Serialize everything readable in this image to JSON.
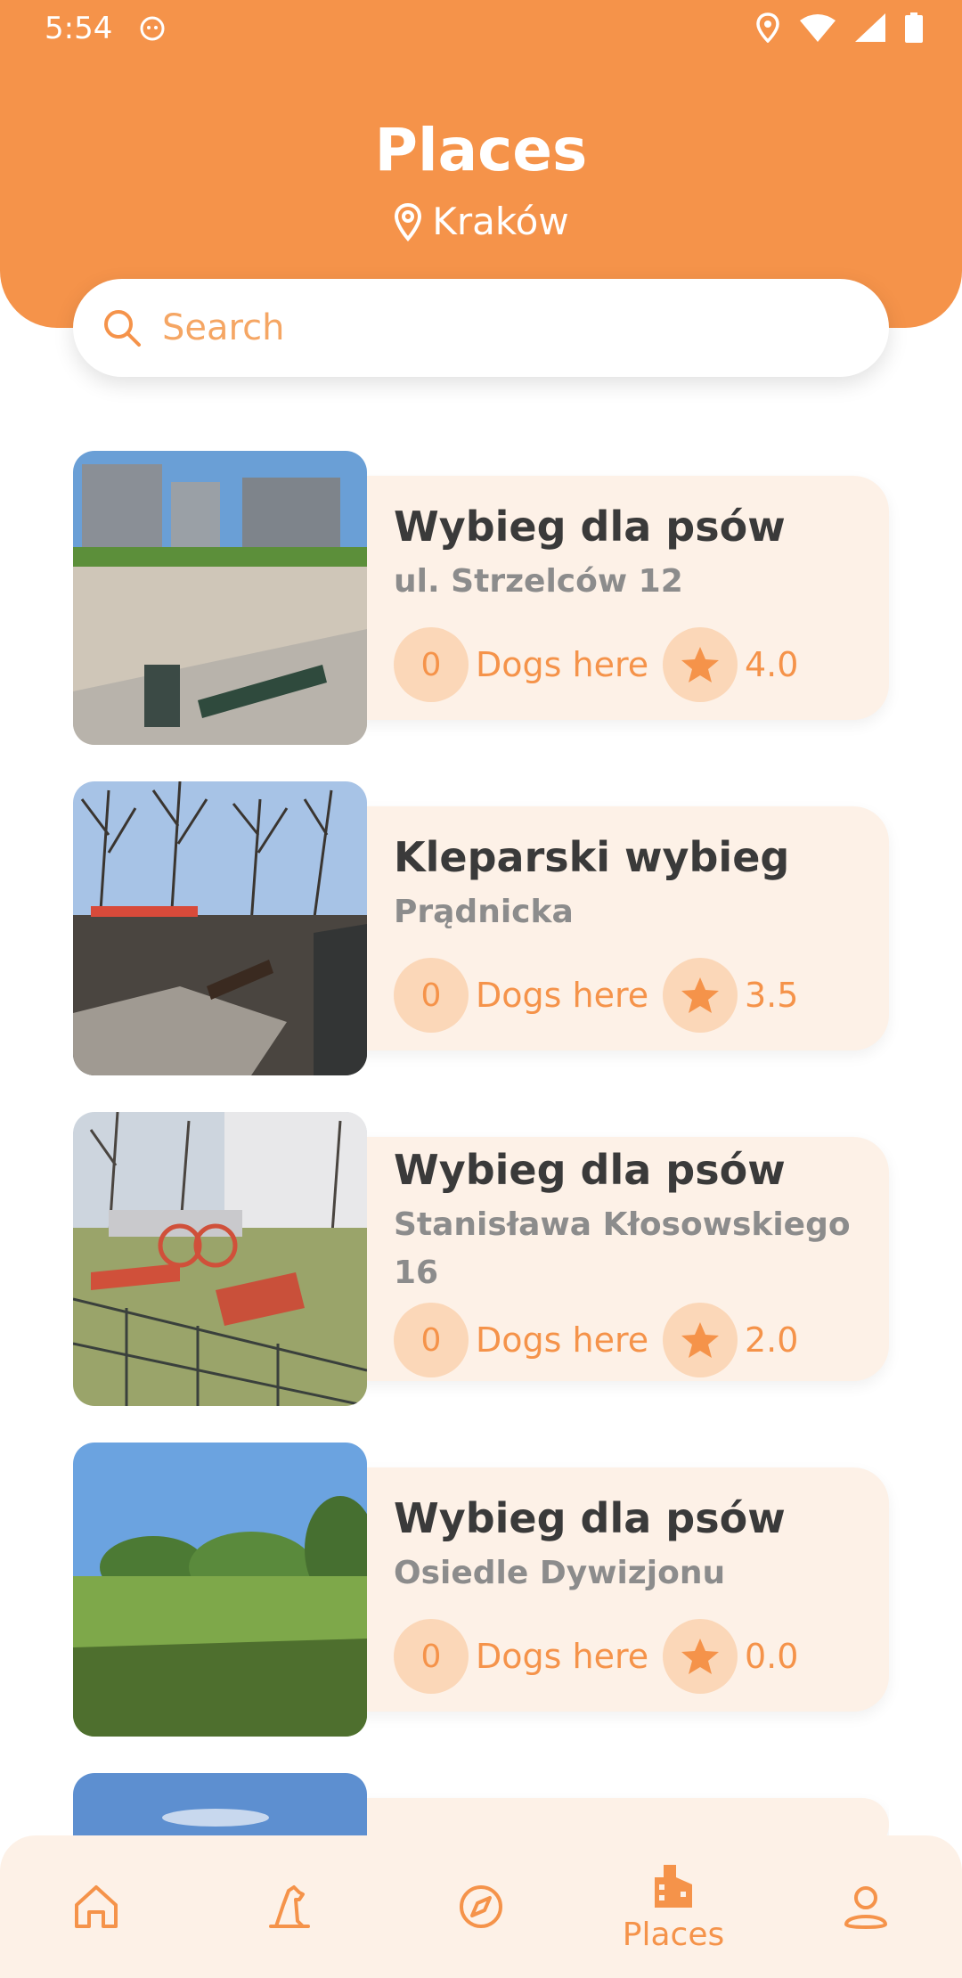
{
  "status_bar": {
    "time": "5:54"
  },
  "header": {
    "title": "Places",
    "city": "Kraków"
  },
  "search": {
    "placeholder": "Search"
  },
  "places": [
    {
      "name": "Wybieg dla psów",
      "address": "ul. Strzelców 12",
      "dogs_count": "0",
      "dogs_label": "Dogs here",
      "rating": "4.0"
    },
    {
      "name": "Kleparski wybieg",
      "address": "Prądnicka",
      "dogs_count": "0",
      "dogs_label": "Dogs here",
      "rating": "3.5"
    },
    {
      "name": "Wybieg dla psów",
      "address": "Stanisława Kłosowskiego 16",
      "dogs_count": "0",
      "dogs_label": "Dogs here",
      "rating": "2.0"
    },
    {
      "name": "Wybieg dla psów",
      "address": "Osiedle Dywizjonu",
      "dogs_count": "0",
      "dogs_label": "Dogs here",
      "rating": "0.0"
    }
  ],
  "bottom_nav": {
    "items": [
      {
        "icon": "home-icon"
      },
      {
        "icon": "dog-icon"
      },
      {
        "icon": "compass-icon"
      },
      {
        "icon": "places-icon",
        "label": "Places",
        "active": true
      },
      {
        "icon": "profile-icon"
      }
    ]
  },
  "colors": {
    "accent": "#F5934A",
    "card_bg": "#FDF1E7",
    "chip_bg": "#FBD7B8"
  }
}
